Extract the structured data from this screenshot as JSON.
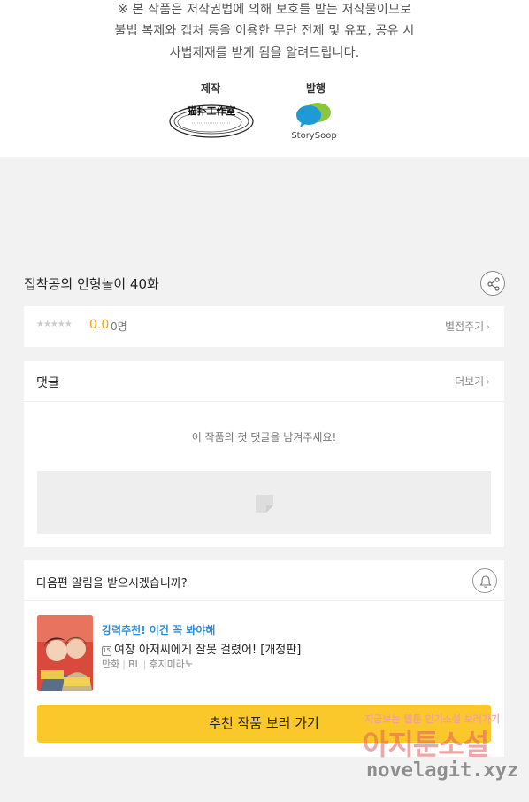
{
  "copyright_notice": {
    "line1": "※ 본 작품은 저작권법에 의해 보호를 받는 저작물이므로",
    "line2": "불법 복제와 캡처 등을 이용한 무단 전제 및 유포, 공유 시",
    "line3": "사법제재를 받게 됨을 알려드립니다."
  },
  "credits": {
    "production_label": "제작",
    "production_logo_text": "猫扑工作室",
    "publisher_label": "발행",
    "publisher_logo_text": "StorySoop"
  },
  "episode": {
    "title": "집착공의 인형놀이 40화"
  },
  "rating": {
    "stars": "★★★★★",
    "score": "0.0",
    "count": "0명",
    "rate_link": "별점주기"
  },
  "comments": {
    "title": "댓글",
    "more_link": "더보기",
    "empty_message": "이 작품의 첫 댓글을 남겨주세요!"
  },
  "next_episode": {
    "question": "다음편 알림을 받으시겠습니까?"
  },
  "recommendation": {
    "tag": "강력추천! 이건 꼭 봐야해",
    "age_badge": "15",
    "title": "여장 아저씨에게 잘못 걸렸어! [개정판]",
    "genre": "만화",
    "category": "BL",
    "author": "후지미라노",
    "button_label": "추천 작품 보러 가기"
  },
  "watermark": {
    "top": "지금보는 웹툰 인기소설 보러가기",
    "middle": "아지툰소설",
    "bottom": "novelagit.xyz"
  },
  "colors": {
    "accent_yellow": "#fbc82b",
    "score_orange": "#f2a600",
    "tag_blue": "#2d8cd9"
  }
}
